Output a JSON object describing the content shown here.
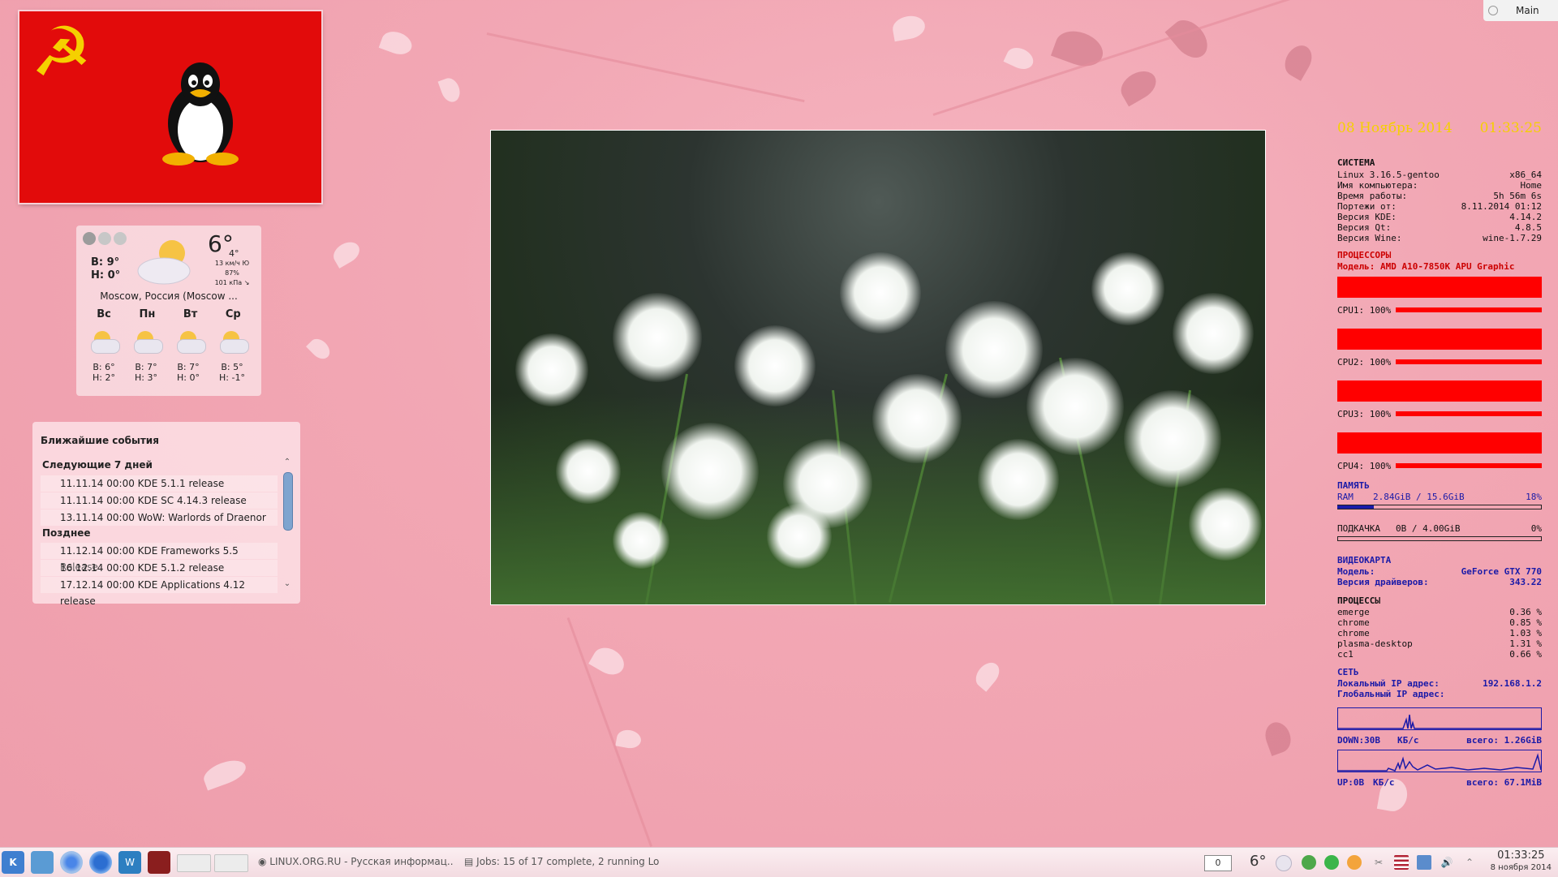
{
  "top_panel": {
    "activity_label": "Main"
  },
  "weather": {
    "temp": "6°",
    "temp_secondary": "4°",
    "high": "В: 9°",
    "low": "Н: 0°",
    "wind": "13 км/ч Ю",
    "humidity": "87%",
    "pressure": "101 кПа ↘",
    "location": "Moscow, Россия (Moscow ...",
    "days": [
      "Вс",
      "Пн",
      "Вт",
      "Ср"
    ],
    "forecast": [
      {
        "hi": "В: 6°",
        "lo": "Н: 2°"
      },
      {
        "hi": "В: 7°",
        "lo": "Н: 3°"
      },
      {
        "hi": "В: 7°",
        "lo": "Н: 0°"
      },
      {
        "hi": "В: 5°",
        "lo": "Н: -1°"
      }
    ]
  },
  "events": {
    "title": "Ближайшие события",
    "group_week": "Следующие 7 дней",
    "group_later": "Позднее",
    "items": [
      "11.11.14 00:00 KDE 5.1.1 release",
      "11.11.14 00:00 KDE SC 4.14.3 release",
      "13.11.14 00:00 WoW: Warlords of Draenor",
      "11.12.14 00:00 KDE Frameworks 5.5 Release",
      "16.12.14 00:00 KDE 5.1.2 release",
      "17.12.14 00:00 KDE Applications 4.12 release"
    ]
  },
  "conky": {
    "date": "08 Ноябрь 2014",
    "time": "01:33:25",
    "system": {
      "header": "СИСТЕМА",
      "rows": [
        {
          "label": "Linux 3.16.5-gentoo",
          "value": "x86_64"
        },
        {
          "label": "Имя компьютера:",
          "value": "Home"
        },
        {
          "label": "Время работы:",
          "value": "5h 56m 6s"
        },
        {
          "label": "Портежи от:",
          "value": "8.11.2014 01:12"
        },
        {
          "label": "Версия KDE:",
          "value": "4.14.2"
        },
        {
          "label": "Версия Qt:",
          "value": "4.8.5"
        },
        {
          "label": "Версия Wine:",
          "value": "wine-1.7.29"
        }
      ]
    },
    "cpu": {
      "header": "ПРОЦЕССОРЫ",
      "model": "Модель:  AMD A10-7850K APU Graphic",
      "cores": [
        {
          "label": "CPU1: 100%",
          "load": 1.0
        },
        {
          "label": "CPU2: 100%",
          "load": 1.0
        },
        {
          "label": "CPU3: 100%",
          "load": 1.0
        },
        {
          "label": "CPU4: 100%",
          "load": 1.0
        }
      ]
    },
    "memory": {
      "header": "ПАМЯТЬ",
      "ram_label": "RAM",
      "ram_value": "2.84GiB / 15.6GiB",
      "ram_percent": "18%",
      "ram_fraction": 0.18,
      "swap_label": "ПОДКАЧКА",
      "swap_value": "0B   / 4.00GiB",
      "swap_percent": "0%"
    },
    "gpu": {
      "header": "ВИДЕОКАРТА",
      "model_label": "Модель:",
      "model_value": "GeForce GTX 770",
      "driver_label": "Версия драйверов:",
      "driver_value": "343.22"
    },
    "processes": {
      "header": "ПРОЦЕССЫ",
      "rows": [
        {
          "name": "emerge",
          "cpu": "0.36 %"
        },
        {
          "name": "chrome",
          "cpu": "0.85 %"
        },
        {
          "name": "chrome",
          "cpu": "1.03 %"
        },
        {
          "name": "plasma-desktop",
          "cpu": "1.31 %"
        },
        {
          "name": "cc1",
          "cpu": "0.66 %"
        }
      ]
    },
    "network": {
      "header": "СЕТЬ",
      "local_label": "Локальный IP адрес:",
      "local_value": "192.168.1.2",
      "global_label": "Глобальный IP адрес:",
      "down_label": "DOWN:30B",
      "down_unit": "КБ/с",
      "down_total": "всего: 1.26GiB",
      "up_label": "UP:0B",
      "up_unit": "КБ/с",
      "up_total": "всего: 67.1MiB"
    }
  },
  "taskbar": {
    "task1": "LINUX.ORG.RU - Русская информац...",
    "task2": "Jobs: 15 of 17 complete, 2 running Lo...",
    "tray_counter": "0",
    "tray_temp": "6°",
    "clock_time": "01:33:25",
    "clock_date": "8 ноября 2014"
  },
  "colors": {
    "conky_red": "#ff0000",
    "conky_blue": "#1a1aa8",
    "conky_yellow": "#f5d000",
    "flag_red": "#e20b0b"
  }
}
